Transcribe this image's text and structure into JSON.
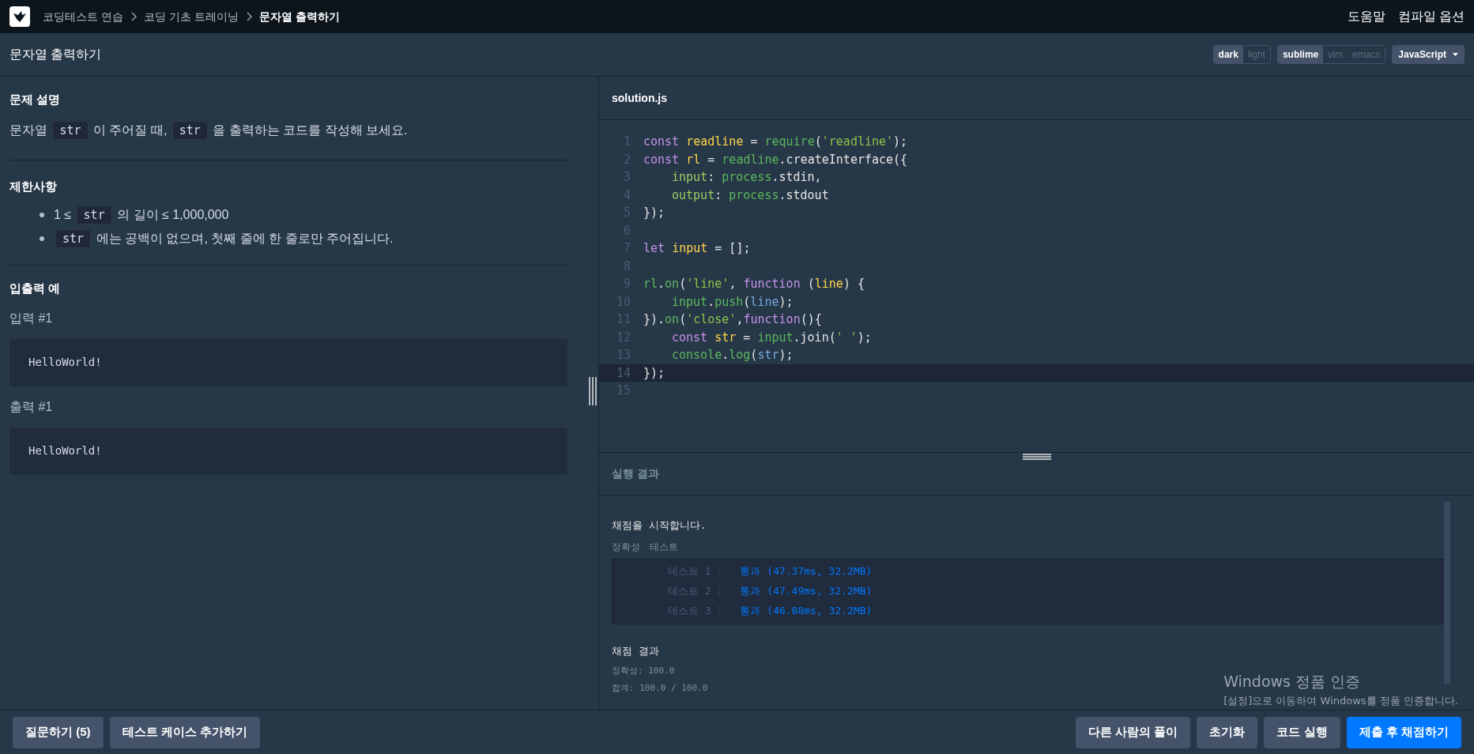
{
  "breadcrumbs": [
    {
      "label": "코딩테스트 연습",
      "current": false
    },
    {
      "label": "코딩 기초 트레이닝",
      "current": false
    },
    {
      "label": "문자열 출력하기",
      "current": true
    }
  ],
  "top_links": [
    "도움말",
    "컴파일 옵션"
  ],
  "title": "문자열 출력하기",
  "theme_toggle": [
    {
      "label": "dark",
      "selected": true
    },
    {
      "label": "light",
      "selected": false
    }
  ],
  "keymap_toggle": [
    {
      "label": "sublime",
      "selected": true
    },
    {
      "label": "vim",
      "selected": false
    },
    {
      "label": "emacs",
      "selected": false
    }
  ],
  "language": "JavaScript",
  "description": {
    "heading": "문제 설명",
    "parts": [
      {
        "kind": "text",
        "text": "문자열 "
      },
      {
        "kind": "code",
        "text": "str"
      },
      {
        "kind": "text",
        "text": " 이 주어질 때, "
      },
      {
        "kind": "code",
        "text": "str"
      },
      {
        "kind": "text",
        "text": " 을 출력하는 코드를 작성해 보세요."
      }
    ]
  },
  "constraints": {
    "heading": "제한사항",
    "items": [
      [
        {
          "kind": "text",
          "text": "1 ≤ "
        },
        {
          "kind": "code",
          "text": "str"
        },
        {
          "kind": "text",
          "text": " 의 길이 ≤ 1,000,000"
        }
      ],
      [
        {
          "kind": "code",
          "text": "str"
        },
        {
          "kind": "text",
          "text": " 에는 공백이 없으며, 첫째 줄에 한 줄로만 주어집니다."
        }
      ]
    ]
  },
  "examples": {
    "heading": "입출력 예",
    "blocks": [
      {
        "label": "입력 #1",
        "content": "HelloWorld!"
      },
      {
        "label": "출력 #1",
        "content": "HelloWorld!"
      }
    ]
  },
  "editor": {
    "filename": "solution.js",
    "lines": [
      {
        "number": "1",
        "active": false,
        "indent": false,
        "tokens": [
          {
            "kind": "keyword",
            "text": "const "
          },
          {
            "kind": "variable",
            "text": "readline"
          },
          {
            "kind": "plain",
            "text": " = "
          },
          {
            "kind": "function",
            "text": "require"
          },
          {
            "kind": "plain",
            "text": "("
          },
          {
            "kind": "string",
            "text": "'readline'"
          },
          {
            "kind": "plain",
            "text": ");"
          }
        ]
      },
      {
        "number": "2",
        "active": false,
        "indent": false,
        "tokens": [
          {
            "kind": "keyword",
            "text": "const "
          },
          {
            "kind": "variable",
            "text": "rl"
          },
          {
            "kind": "plain",
            "text": " = "
          },
          {
            "kind": "function",
            "text": "readline"
          },
          {
            "kind": "plain",
            "text": ".createInterface({"
          }
        ]
      },
      {
        "number": "3",
        "active": false,
        "indent": true,
        "tokens": [
          {
            "kind": "property",
            "text": "input"
          },
          {
            "kind": "plain",
            "text": ": "
          },
          {
            "kind": "function",
            "text": "process"
          },
          {
            "kind": "plain",
            "text": ".stdin,"
          }
        ]
      },
      {
        "number": "4",
        "active": false,
        "indent": true,
        "tokens": [
          {
            "kind": "property",
            "text": "output"
          },
          {
            "kind": "plain",
            "text": ": "
          },
          {
            "kind": "function",
            "text": "process"
          },
          {
            "kind": "plain",
            "text": ".stdout"
          }
        ]
      },
      {
        "number": "5",
        "active": false,
        "indent": false,
        "tokens": [
          {
            "kind": "plain",
            "text": "});"
          }
        ]
      },
      {
        "number": "6",
        "active": false
      },
      {
        "number": "7",
        "active": false,
        "indent": false,
        "tokens": [
          {
            "kind": "keyword",
            "text": "let "
          },
          {
            "kind": "variable",
            "text": "input"
          },
          {
            "kind": "plain",
            "text": " = [];"
          }
        ]
      },
      {
        "number": "8",
        "active": false
      },
      {
        "number": "9",
        "active": false,
        "indent": false,
        "tokens": [
          {
            "kind": "function",
            "text": "rl"
          },
          {
            "kind": "plain",
            "text": "."
          },
          {
            "kind": "function",
            "text": "on"
          },
          {
            "kind": "plain",
            "text": "("
          },
          {
            "kind": "string",
            "text": "'line'"
          },
          {
            "kind": "plain",
            "text": ", "
          },
          {
            "kind": "keyword",
            "text": "function"
          },
          {
            "kind": "plain",
            "text": " ("
          },
          {
            "kind": "variable",
            "text": "line"
          },
          {
            "kind": "plain",
            "text": ") {"
          }
        ]
      },
      {
        "number": "10",
        "active": false,
        "indent": true,
        "tokens": [
          {
            "kind": "function",
            "text": "input"
          },
          {
            "kind": "plain",
            "text": "."
          },
          {
            "kind": "function",
            "text": "push"
          },
          {
            "kind": "plain",
            "text": "("
          },
          {
            "kind": "param",
            "text": "line"
          },
          {
            "kind": "plain",
            "text": ");"
          }
        ]
      },
      {
        "number": "11",
        "active": false,
        "indent": false,
        "tokens": [
          {
            "kind": "plain",
            "text": "})."
          },
          {
            "kind": "function",
            "text": "on"
          },
          {
            "kind": "plain",
            "text": "("
          },
          {
            "kind": "string",
            "text": "'close'"
          },
          {
            "kind": "plain",
            "text": ","
          },
          {
            "kind": "keyword",
            "text": "function"
          },
          {
            "kind": "plain",
            "text": "(){"
          }
        ]
      },
      {
        "number": "12",
        "active": false,
        "indent": true,
        "tokens": [
          {
            "kind": "keyword",
            "text": "const "
          },
          {
            "kind": "variable",
            "text": "str"
          },
          {
            "kind": "plain",
            "text": " = "
          },
          {
            "kind": "function",
            "text": "input"
          },
          {
            "kind": "plain",
            "text": ".join("
          },
          {
            "kind": "string",
            "text": "' '"
          },
          {
            "kind": "plain",
            "text": ");"
          }
        ]
      },
      {
        "number": "13",
        "active": false,
        "indent": true,
        "tokens": [
          {
            "kind": "function",
            "text": "console"
          },
          {
            "kind": "plain",
            "text": "."
          },
          {
            "kind": "function",
            "text": "log"
          },
          {
            "kind": "plain",
            "text": "("
          },
          {
            "kind": "param",
            "text": "str"
          },
          {
            "kind": "plain",
            "text": ");"
          }
        ]
      },
      {
        "number": "14",
        "active": true,
        "indent": false,
        "tokens": [
          {
            "kind": "plain",
            "text": "});"
          }
        ]
      },
      {
        "number": "15",
        "active": false
      }
    ]
  },
  "results": {
    "heading": "실행 결과",
    "start_message": "채점을 시작합니다.",
    "group_labels": [
      "정확성",
      "테스트"
    ],
    "tests": [
      {
        "label": "테스트 1 〉",
        "result": "통과 (47.37ms, 32.2MB)"
      },
      {
        "label": "테스트 2 〉",
        "result": "통과 (47.49ms, 32.2MB)"
      },
      {
        "label": "테스트 3 〉",
        "result": "통과 (46.88ms, 32.2MB)"
      }
    ],
    "summary_heading": "채점 결과",
    "summary_lines": [
      "정확성: 100.0",
      "합계: 100.0 / 100.0"
    ]
  },
  "os_notice": {
    "title": "Windows 정품 인증",
    "message": "[설정]으로 이동하여 Windows를 정품 인증합니다."
  },
  "left_buttons": [
    {
      "label": "질문하기 (5)",
      "kind": "secondary"
    },
    {
      "label": "테스트 케이스 추가하기",
      "kind": "secondary"
    }
  ],
  "right_buttons": [
    {
      "label": "다른 사람의 풀이",
      "kind": "secondary"
    },
    {
      "label": "초기화",
      "kind": "secondary"
    },
    {
      "label": "코드 실행",
      "kind": "secondary"
    },
    {
      "label": "제출 후 채점하기",
      "kind": "primary"
    }
  ]
}
